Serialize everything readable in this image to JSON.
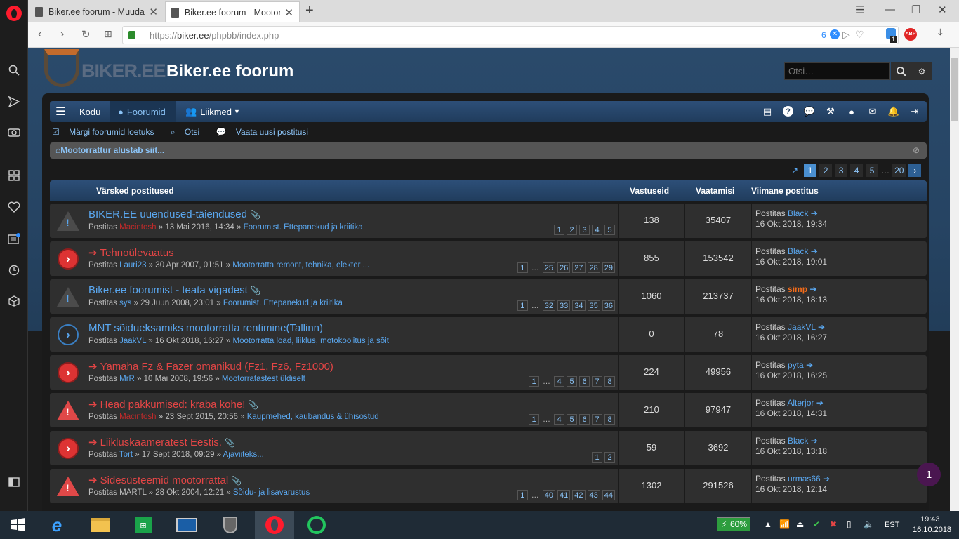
{
  "browser": {
    "tabs": [
      {
        "label": "Biker.ee foorum - Muuda p"
      },
      {
        "label": "Biker.ee foorum - Mootorr"
      }
    ],
    "url_scheme": "https://",
    "url_host": "biker.ee",
    "url_path": "/phpbb/index.php",
    "tracker_count": "6",
    "ext_badge": "1",
    "abp_label": "ABP"
  },
  "site": {
    "logo_text": "BIKER.EE",
    "title": "Biker.ee foorum",
    "search_placeholder": "Otsi…"
  },
  "nav": {
    "home": "Kodu",
    "forums": "Foorumid",
    "members": "Liikmed"
  },
  "subnav": {
    "mark_read": "Märgi foorumid loetuks",
    "search": "Otsi",
    "new_posts": "Vaata uusi postitusi"
  },
  "announcement": "Mootorrattur alustab siit...",
  "pager": [
    "1",
    "2",
    "3",
    "4",
    "5",
    "…",
    "20"
  ],
  "columns": {
    "topics": "Värsked postitused",
    "replies": "Vastuseid",
    "views": "Vaatamisi",
    "last_post": "Viimane postitus"
  },
  "labels": {
    "posted_by": "Postitas"
  },
  "topics": [
    {
      "title": "BIKER.EE uuendused-täiendused",
      "author": "Macintosh",
      "date": "13 Mai 2016, 14:34",
      "forum": "Foorumist. Ettepanekud ja kriitika",
      "pages": [
        "1",
        "2",
        "3",
        "4",
        "5"
      ],
      "replies": "138",
      "views": "35407",
      "last_author": "Black",
      "last_date": "16 Okt 2018, 19:34"
    },
    {
      "title": "Tehnoülevaatus",
      "author": "Lauri23",
      "date": "30 Apr 2007, 01:51",
      "forum": "Mootorratta remont, tehnika, elekter ...",
      "pages": [
        "1",
        "…",
        "25",
        "26",
        "27",
        "28",
        "29"
      ],
      "replies": "855",
      "views": "153542",
      "last_author": "Black",
      "last_date": "16 Okt 2018, 19:01"
    },
    {
      "title": "Biker.ee foorumist - teata vigadest",
      "author": "sys",
      "date": "29 Juun 2008, 23:01",
      "forum": "Foorumist. Ettepanekud ja kriitika",
      "pages": [
        "1",
        "…",
        "32",
        "33",
        "34",
        "35",
        "36"
      ],
      "replies": "1060",
      "views": "213737",
      "last_author": "simp",
      "last_date": "16 Okt 2018, 18:13"
    },
    {
      "title": "MNT sõidueksamiks mootorratta rentimine(Tallinn)",
      "author": "JaakVL",
      "date": "16 Okt 2018, 16:27",
      "forum": "Mootorratta load, liiklus, motokoolitus ja sõit",
      "pages": [],
      "replies": "0",
      "views": "78",
      "last_author": "JaakVL",
      "last_date": "16 Okt 2018, 16:27"
    },
    {
      "title": "Yamaha Fz & Fazer omanikud (Fz1, Fz6, Fz1000)",
      "author": "MrR",
      "date": "10 Mai 2008, 19:56",
      "forum": "Mootorratastest üldiselt",
      "pages": [
        "1",
        "…",
        "4",
        "5",
        "6",
        "7",
        "8"
      ],
      "replies": "224",
      "views": "49956",
      "last_author": "pyta",
      "last_date": "16 Okt 2018, 16:25"
    },
    {
      "title": "Head pakkumised: kraba kohe!",
      "author": "Macintosh",
      "date": "23 Sept 2015, 20:56",
      "forum": "Kaupmehed, kaubandus & ühisostud",
      "pages": [
        "1",
        "…",
        "4",
        "5",
        "6",
        "7",
        "8"
      ],
      "replies": "210",
      "views": "97947",
      "last_author": "Alterjor",
      "last_date": "16 Okt 2018, 14:31"
    },
    {
      "title": "Liikluskaameratest Eestis.",
      "author": "Tort",
      "date": "17 Sept 2018, 09:29",
      "forum": "Ajaviiteks...",
      "pages": [
        "1",
        "2"
      ],
      "replies": "59",
      "views": "3692",
      "last_author": "Black",
      "last_date": "16 Okt 2018, 13:18"
    },
    {
      "title": "Sidesüsteemid mootorrattal",
      "author": "MARTL",
      "date": "28 Okt 2004, 12:21",
      "forum": "Sõidu- ja lisavarustus",
      "pages": [
        "1",
        "…",
        "40",
        "41",
        "42",
        "43",
        "44"
      ],
      "replies": "1302",
      "views": "291526",
      "last_author": "urmas66",
      "last_date": "16 Okt 2018, 12:14"
    }
  ],
  "notification_badge": "1",
  "taskbar": {
    "battery": "60%",
    "lang": "EST",
    "time": "19:43",
    "date": "16.10.2018"
  },
  "colors": {
    "accent_blue": "#5aa7ef",
    "hot_red": "#e34545",
    "navbar": "#2d4f78"
  }
}
